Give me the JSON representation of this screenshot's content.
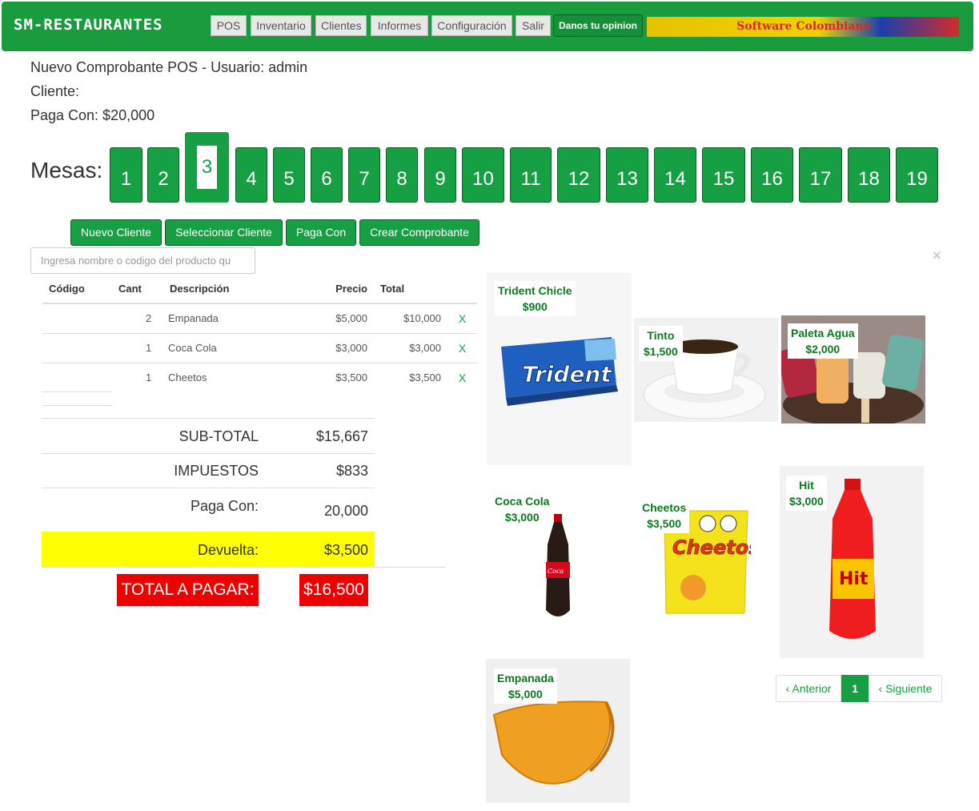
{
  "app": {
    "brand": "SM-RESTAURANTES"
  },
  "nav": {
    "items": [
      "POS",
      "Inventario",
      "Clientes",
      "Informes",
      "Configuración",
      "Salir"
    ],
    "opinion": "Danos tu opinion",
    "banner": "Software Colombiano"
  },
  "header": {
    "title": "Nuevo Comprobante POS - Usuario: admin",
    "cliente": "Cliente:",
    "paga_con": "Paga Con: $20,000"
  },
  "mesas": {
    "label": "Mesas:",
    "tables": [
      "1",
      "2",
      "3",
      "4",
      "5",
      "6",
      "7",
      "8",
      "9",
      "10",
      "11",
      "12",
      "13",
      "14",
      "15",
      "16",
      "17",
      "18",
      "19"
    ],
    "selected": "3"
  },
  "actions": {
    "nuevo_cliente": "Nuevo Cliente",
    "seleccionar_cliente": "Seleccionar Cliente",
    "paga_con": "Paga Con",
    "crear_comprobante": "Crear Comprobante"
  },
  "search": {
    "placeholder": "Ingresa nombre o codigo del producto qu"
  },
  "table": {
    "headers": [
      "Código",
      "Cant",
      "Descripción",
      "Precio",
      "Total"
    ],
    "rows": [
      {
        "codigo": "",
        "cant": "2",
        "desc": "Empanada",
        "precio": "$5,000",
        "total": "$10,000",
        "del": "X"
      },
      {
        "codigo": "",
        "cant": "1",
        "desc": "Coca Cola",
        "precio": "$3,000",
        "total": "$3,000",
        "del": "X"
      },
      {
        "codigo": "",
        "cant": "1",
        "desc": "Cheetos",
        "precio": "$3,500",
        "total": "$3,500",
        "del": "X"
      }
    ]
  },
  "summary": {
    "subtotal_label": "SUB-TOTAL",
    "subtotal": "$15,667",
    "impuestos_label": "IMPUESTOS",
    "impuestos": "$833",
    "paga_con_label": "Paga Con:",
    "paga_con": "20,000",
    "devuelta_label": "Devuelta:",
    "devuelta": "$3,500",
    "total_label": "TOTAL A PAGAR:",
    "total": "$16,500"
  },
  "products": [
    {
      "name": "Trident Chicle",
      "price": "$900"
    },
    {
      "name": "Tinto",
      "price": "$1,500"
    },
    {
      "name": "Paleta Agua",
      "price": "$2,000"
    },
    {
      "name": "Coca Cola",
      "price": "$3,000"
    },
    {
      "name": "Cheetos",
      "price": "$3,500"
    },
    {
      "name": "Hit",
      "price": "$3,000"
    },
    {
      "name": "Empanada",
      "price": "$5,000"
    }
  ],
  "pager": {
    "prev": "‹ Anterior",
    "current": "1",
    "next": "‹ Siguiente"
  },
  "close": "×",
  "colors": {
    "primary": "#16a043",
    "nav": "#1a9c3e",
    "highlight": "#ffff00",
    "total": "#ee0000"
  }
}
